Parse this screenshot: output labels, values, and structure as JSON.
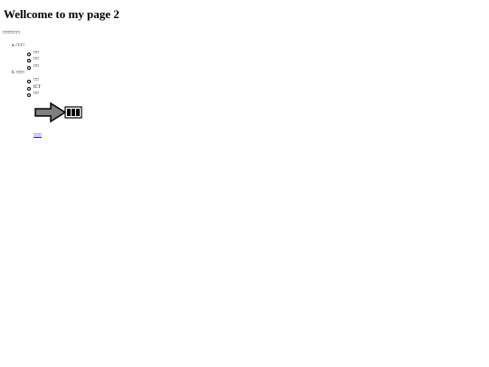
{
  "page": {
    "title": "Wellcome to my page 2",
    "intro": "□□□□□□:"
  },
  "outline": [
    {
      "marker": "a.",
      "label": "□□□",
      "items": [
        "□□",
        "□□",
        "□□"
      ]
    },
    {
      "marker": "b.",
      "label": "□□□",
      "items": [
        "□□",
        "ICT",
        "□□"
      ]
    }
  ],
  "arrow_icon": "arrow-right-icon",
  "link": {
    "label": "□□□"
  }
}
